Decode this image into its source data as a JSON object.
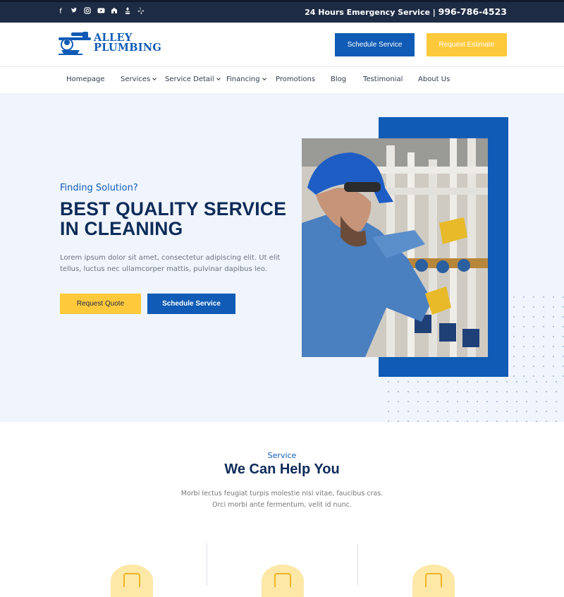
{
  "topbar": {
    "social_icons": [
      "facebook-icon",
      "twitter-icon",
      "instagram-icon",
      "youtube-icon",
      "houzz-icon",
      "bbb-icon",
      "yelp-icon"
    ],
    "emergency_label": "24 Hours Emergency Service |",
    "phone": "996-786-4523"
  },
  "header": {
    "logo_line1": "ALLEY",
    "logo_line2": "PLUMBING",
    "schedule_label": "Schedule Service",
    "estimate_label": "Request Estimate"
  },
  "nav": {
    "items": [
      {
        "label": "Homepage",
        "dropdown": false
      },
      {
        "label": "Services",
        "dropdown": true
      },
      {
        "label": "Service Detail",
        "dropdown": true
      },
      {
        "label": "Financing",
        "dropdown": true
      },
      {
        "label": "Promotions",
        "dropdown": false
      },
      {
        "label": "Blog",
        "dropdown": false
      },
      {
        "label": "Testimonial",
        "dropdown": false
      },
      {
        "label": "About Us",
        "dropdown": false
      }
    ]
  },
  "hero": {
    "kicker": "Finding Solution?",
    "title_line1": "BEST QUALITY SERVICE",
    "title_line2": "IN CLEANING",
    "body": "Lorem ipsum dolor sit amet, consectetur adipiscing elit. Ut elit tellus, luctus nec ullamcorper mattis, pulvinar dapibus leo.",
    "quote_label": "Request Quote",
    "schedule_label": "Schedule Service"
  },
  "services": {
    "kicker": "Service",
    "title": "We Can Help You",
    "body_line1": "Morbi lectus feugiat turpis molestie nisi vitae, faucibus cras.",
    "body_line2": "Orci morbi ante fermentum, velit id nunc."
  },
  "colors": {
    "brand_blue": "#0f5bb5",
    "accent_yellow": "#ffc93c",
    "navy": "#0d2b59",
    "topbar": "#1e2b44",
    "hero_bg": "#f0f5fd"
  }
}
